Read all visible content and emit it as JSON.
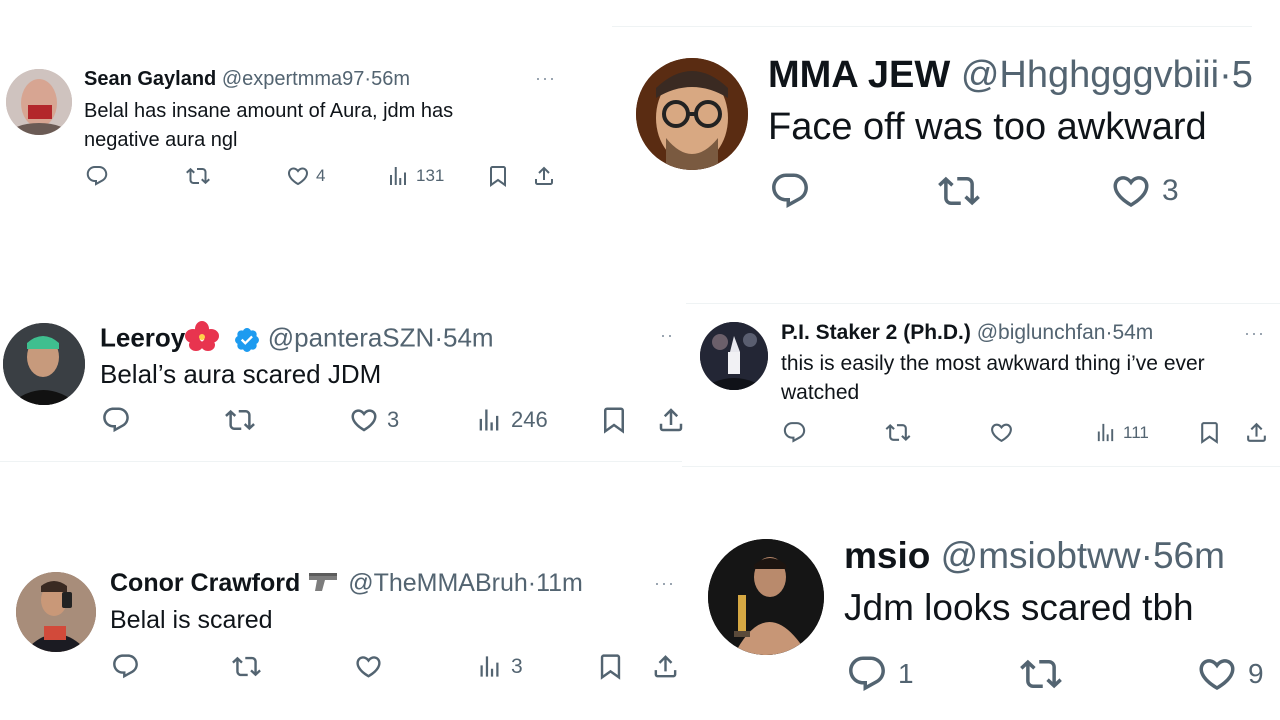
{
  "colors": {
    "text": "#0f1419",
    "muted": "#536471",
    "verified": "#1d9bf0",
    "divider": "#eff3f4"
  },
  "tweets": [
    {
      "name": "Sean Gayland",
      "handle": "@expertmma97",
      "sep": "·",
      "time": "56m",
      "text": "Belal has insane amount of Aura, jdm has\nnegative aura ngl",
      "likes": "4",
      "views": "131",
      "more": "···"
    },
    {
      "name": "MMA JEW",
      "handle": "@Hhghgggvbiii",
      "sep": "·",
      "time": "5",
      "text": "Face off was too awkward",
      "likes": "3"
    },
    {
      "name": "Leeroy",
      "name_emoji": "hibiscus-emoji",
      "verified_icon": "verified-badge-icon",
      "handle": "@panteraSZN",
      "sep": "·",
      "time": "54m",
      "text": "Belal’s aura scared JDM",
      "likes": "3",
      "views": "246",
      "more": "··"
    },
    {
      "name": "P.I. Staker 2 (Ph.D.)",
      "handle": "@biglunchfan",
      "sep": "·",
      "time": "54m",
      "text": "this is easily the most awkward thing i’ve ever\nwatched",
      "views": "111",
      "more": "···"
    },
    {
      "name": "Conor Crawford",
      "name_emoji": "pistol-emoji",
      "handle": "@TheMMABruh",
      "sep": "·",
      "time": "11m",
      "text": "Belal is scared",
      "views": "3",
      "more": "···"
    },
    {
      "name": "msio",
      "handle": "@msiobtww",
      "sep": "·",
      "time": "56m",
      "text": "Jdm looks scared tbh",
      "replies": "1",
      "likes": "9"
    }
  ]
}
